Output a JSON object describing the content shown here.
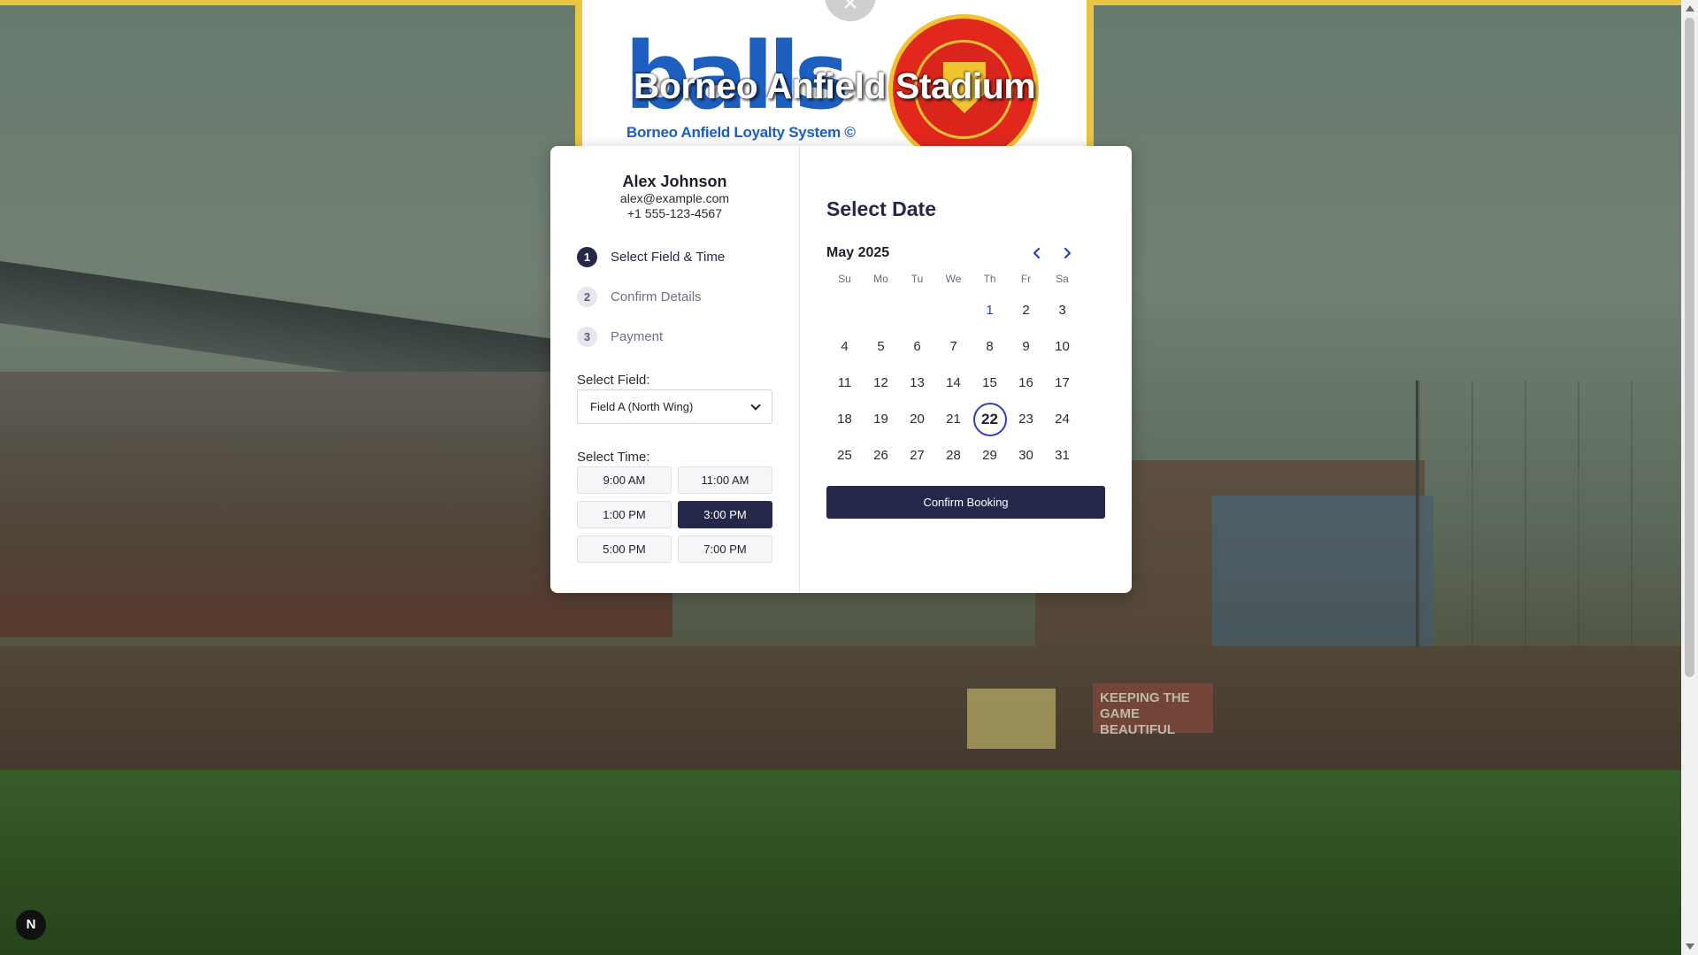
{
  "header": {
    "logo_text": "balls",
    "logo_subtitle": "Borneo Anfield Loyalty System ©",
    "title": "Borneo Anfield Stadium",
    "close_symbol": "×"
  },
  "user": {
    "name": "Alex Johnson",
    "email": "alex@example.com",
    "phone": "+1 555-123-4567"
  },
  "steps": [
    {
      "num": "1",
      "label": "Select Field & Time",
      "active": true
    },
    {
      "num": "2",
      "label": "Confirm Details",
      "active": false
    },
    {
      "num": "3",
      "label": "Payment",
      "active": false
    }
  ],
  "field": {
    "label": "Select Field:",
    "selected": "Field A (North Wing)"
  },
  "time": {
    "label": "Select Time:",
    "slots": [
      "9:00 AM",
      "11:00 AM",
      "1:00 PM",
      "3:00 PM",
      "5:00 PM",
      "7:00 PM"
    ],
    "selected": "3:00 PM"
  },
  "calendar": {
    "section_title": "Select Date",
    "month": "May 2025",
    "weekdays": [
      "Su",
      "Mo",
      "Tu",
      "We",
      "Th",
      "Fr",
      "Sa"
    ],
    "first_weekday_index": 4,
    "days_in_month": 31,
    "today": 1,
    "selected": 22
  },
  "confirm_label": "Confirm Booking",
  "bg_signs": {
    "keep": "KEEPING THE GAME BEAUTIFUL"
  },
  "dev_badge": "N",
  "colors": {
    "accent": "#26284a",
    "brand_blue": "#1c5fbf",
    "highlight": "#2b3fbf",
    "border_yellow": "#e8c542"
  }
}
